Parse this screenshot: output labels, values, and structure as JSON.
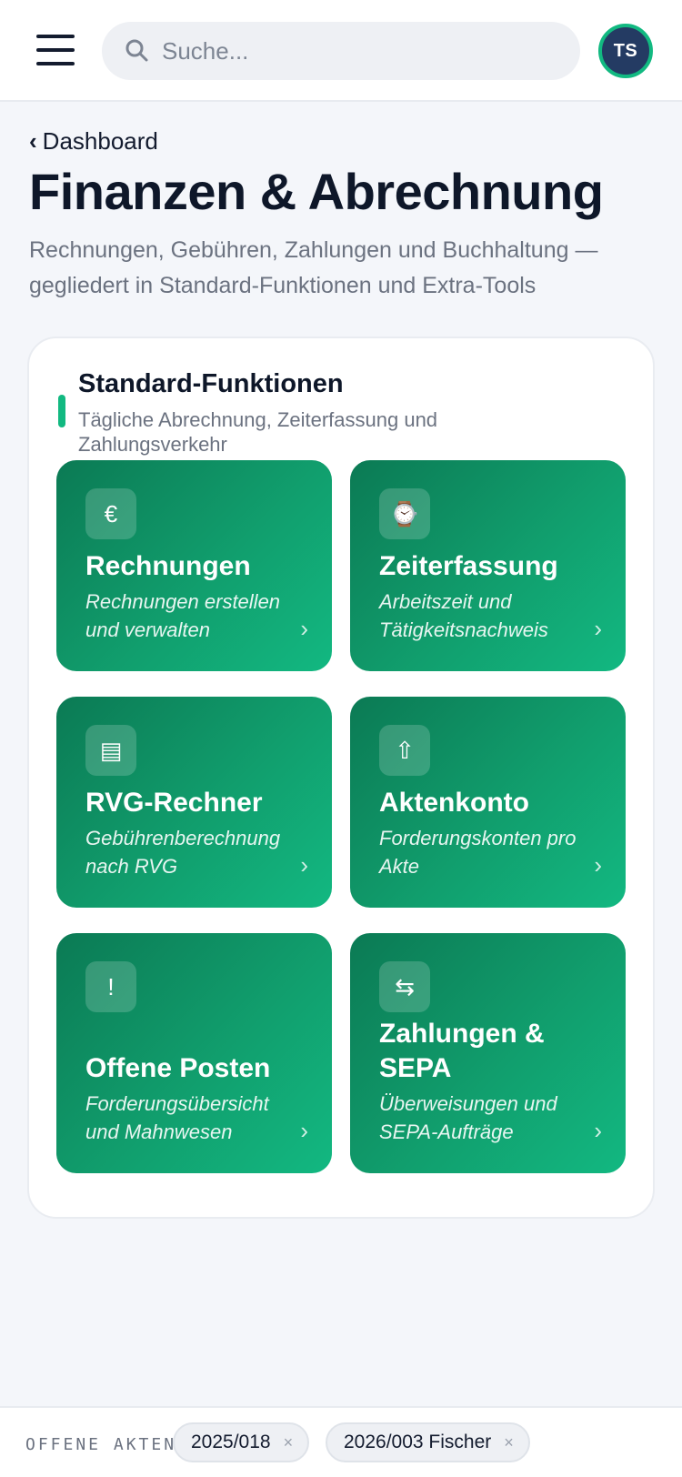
{
  "topbar": {
    "search_placeholder": "Suche...",
    "avatar_initials": "TS"
  },
  "header": {
    "back_label": "Dashboard",
    "title": "Finanzen & Abrechnung",
    "subtitle": "Rechnungen, Gebühren, Zahlungen und Buchhaltung — gegliedert in Standard-Funktionen und Extra-Tools"
  },
  "section": {
    "title": "Standard-Funktionen",
    "subtitle": "Tägliche Abrechnung, Zeiterfassung und Zahlungsverkehr"
  },
  "tiles": [
    {
      "title": "Rechnungen",
      "desc": "Rechnungen erstellen und verwalten",
      "icon": "€",
      "icon_name": "euro-icon"
    },
    {
      "title": "Zeiterfassung",
      "desc": "Arbeitszeit und Tätigkeitsnachweis",
      "icon": "⌚",
      "icon_name": "watch-icon"
    },
    {
      "title": "RVG-Rechner",
      "desc": "Gebührenberechnung nach RVG",
      "icon": "▤",
      "icon_name": "calculator-icon"
    },
    {
      "title": "Aktenkonto",
      "desc": "Forderungskonten pro Akte",
      "icon": "⇧",
      "icon_name": "upload-icon"
    },
    {
      "title": "Offene Posten",
      "desc": "Forderungsübersicht und Mahnwesen",
      "icon": "!",
      "icon_name": "alert-icon"
    },
    {
      "title": "Zahlungen & SEPA",
      "desc": "Überweisungen und SEPA-Aufträge",
      "icon": "⇆",
      "icon_name": "transfer-icon"
    }
  ],
  "bottombar": {
    "label": "OFFENE AKTEN",
    "chips": [
      {
        "label": "2025/018"
      },
      {
        "label": "2026/003 Fischer"
      }
    ]
  },
  "colors": {
    "accent": "#12b981",
    "tile_dark": "#0b7a54",
    "tile_light": "#12b881",
    "avatar_bg": "#243b63"
  }
}
